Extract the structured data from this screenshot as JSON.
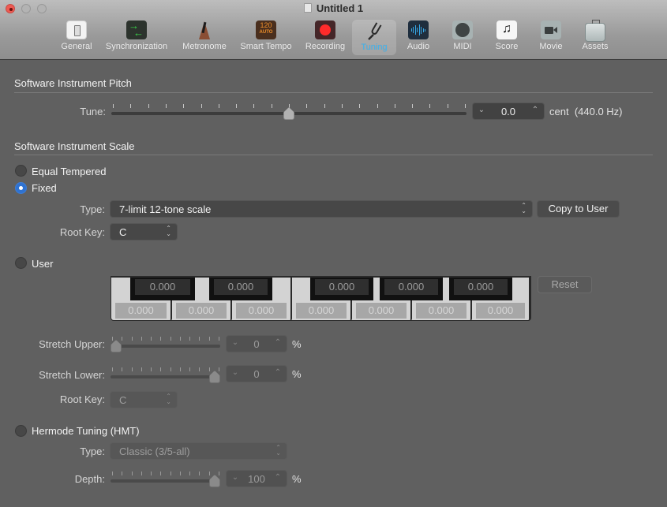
{
  "window": {
    "title": "Untitled 1"
  },
  "toolbar": {
    "items": [
      {
        "label": "General",
        "icon": "general-icon"
      },
      {
        "label": "Synchronization",
        "icon": "synchronization-icon"
      },
      {
        "label": "Metronome",
        "icon": "metronome-icon"
      },
      {
        "label": "Smart Tempo",
        "icon": "smart-tempo-icon",
        "icon_text": "120",
        "icon_subtext": "AUTO"
      },
      {
        "label": "Recording",
        "icon": "record-icon"
      },
      {
        "label": "Tuning",
        "icon": "tuning-fork-icon",
        "active": true
      },
      {
        "label": "Audio",
        "icon": "audio-waveform-icon"
      },
      {
        "label": "MIDI",
        "icon": "midi-connector-icon"
      },
      {
        "label": "Score",
        "icon": "music-note-icon",
        "icon_text": "♫"
      },
      {
        "label": "Movie",
        "icon": "video-camera-icon"
      },
      {
        "label": "Assets",
        "icon": "briefcase-icon"
      }
    ],
    "active_color": "#3fb4f0"
  },
  "pitch": {
    "section_title": "Software Instrument Pitch",
    "tune_label": "Tune:",
    "tune_position": 0.5,
    "tune_tick_count": 21,
    "tune_value": "0.0",
    "tune_unit": "cent",
    "tune_hz": "(440.0 Hz)"
  },
  "scale": {
    "section_title": "Software Instrument Scale",
    "equal_tempered_label": "Equal Tempered",
    "fixed_label": "Fixed",
    "selected": "fixed",
    "type_label": "Type:",
    "type_value": "7-limit 12-tone scale",
    "copy_to_user_label": "Copy to User",
    "root_key_label": "Root Key:",
    "root_key_value": "C"
  },
  "user": {
    "label": "User",
    "black_keys": [
      "0.000",
      "0.000",
      "0.000",
      "0.000",
      "0.000"
    ],
    "white_keys": [
      "0.000",
      "0.000",
      "0.000",
      "0.000",
      "0.000",
      "0.000",
      "0.000"
    ],
    "reset_label": "Reset",
    "stretch_upper_label": "Stretch Upper:",
    "stretch_upper_value": "0",
    "stretch_upper_position": 0.0,
    "stretch_lower_label": "Stretch Lower:",
    "stretch_lower_value": "0",
    "stretch_lower_position": 1.0,
    "stretch_tick_count": 12,
    "percent": "%",
    "root_key_label": "Root Key:",
    "root_key_value": "C"
  },
  "hermode": {
    "label": "Hermode Tuning (HMT)",
    "type_label": "Type:",
    "type_value": "Classic (3/5-all)",
    "depth_label": "Depth:",
    "depth_value": "100",
    "depth_position": 1.0,
    "percent": "%"
  },
  "glyphs": {
    "chevron_down": "⌄",
    "chevron_up": "⌃",
    "updown": "⌃\n⌄"
  }
}
